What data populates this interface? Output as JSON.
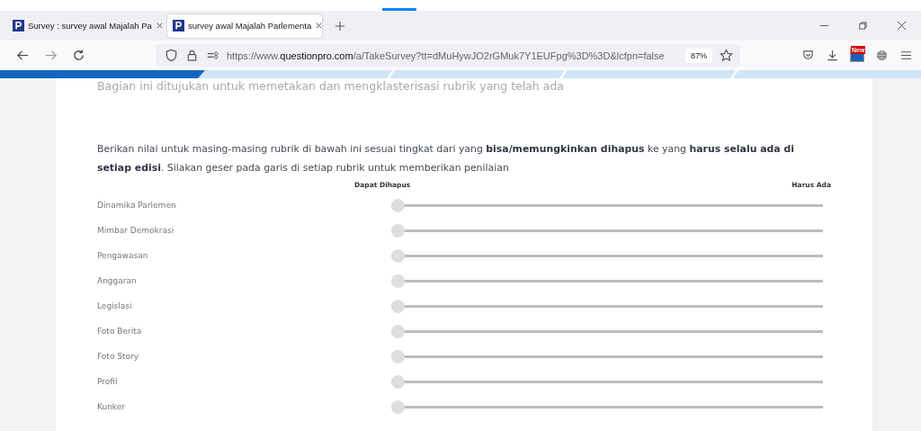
{
  "browser": {
    "tabs": [
      {
        "title": "Survey : survey awal Majalah Pa",
        "selected": false
      },
      {
        "title": "survey awal Majalah Parlementa",
        "selected": true
      }
    ],
    "url": {
      "prefix": "https://www.",
      "domain": "questionpro.com",
      "path": "/a/TakeSurvey?tt=dMuHywJO2rGMuk7Y1EUFpg%3D%3D&lcfpn=false"
    },
    "zoom": "87%",
    "badge": "New"
  },
  "survey": {
    "section_description": "Bagian ini ditujukan untuk memetakan dan mengklasterisasi rubrik yang telah ada",
    "instructions": "Berikan nilai untuk masing-masing rubrik di bawah ini sesuai tingkat dari yang **bisa/memungkinkan dihapus** ke yang **harus selalu ada di setiap edisi**. Silakan geser pada garis di setiap rubrik untuk memberikan penilaian",
    "scale_min": "Dapat Dihapus",
    "scale_max": "Harus Ada",
    "rows": [
      {
        "label": "Dinamika Parlemen",
        "level": 0
      },
      {
        "label": "Mimbar Demokrasi",
        "level": 0
      },
      {
        "label": "Pengawasan",
        "level": 0
      },
      {
        "label": "Anggaran",
        "level": 0
      },
      {
        "label": "Legislasi",
        "level": 0
      },
      {
        "label": "Foto Berita",
        "level": 0
      },
      {
        "label": "Foto Story",
        "level": 0
      },
      {
        "label": "Profil",
        "level": 0
      },
      {
        "label": "Kunker",
        "level": 0
      }
    ]
  }
}
